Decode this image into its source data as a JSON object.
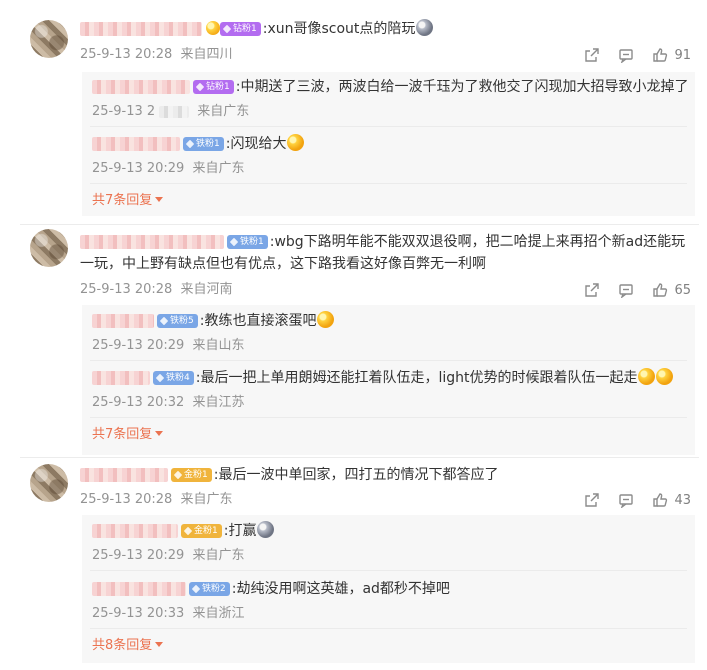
{
  "comments": [
    {
      "badge": {
        "label": "钻粉1",
        "color": "#b36cf0"
      },
      "text": ":xun哥像scout点的陪玩",
      "date": "25-9-13 20:28",
      "location": "来自四川",
      "likes": "91",
      "replies": [
        {
          "badge": {
            "label": "钻粉1",
            "color": "#b36cf0"
          },
          "text": ":中期送了三波，两波白给一波千珏为了救他交了闪现加大招导致小龙掉了",
          "date": "25-9-13 2",
          "location": "来自广东"
        },
        {
          "badge": {
            "label": "铁粉1",
            "color": "#7aa6e6"
          },
          "text": ":闪现给大",
          "date": "25-9-13 20:29",
          "location": "来自广东"
        }
      ],
      "more_label": "共7条回复"
    },
    {
      "badge": {
        "label": "铁粉1",
        "color": "#7aa6e6"
      },
      "text": ":wbg下路明年能不能双双退役啊，把二哈提上来再招个新ad还能玩一玩，中上野有缺点但也有优点，这下路我看这好像百弊无一利啊",
      "date": "25-9-13 20:28",
      "location": "来自河南",
      "likes": "65",
      "replies": [
        {
          "badge": {
            "label": "铁粉5",
            "color": "#7aa6e6"
          },
          "text": ":教练也直接滚蛋吧",
          "date": "25-9-13 20:29",
          "location": "来自山东"
        },
        {
          "badge": {
            "label": "铁粉4",
            "color": "#7aa6e6"
          },
          "text": ":最后一把上单用朗姆还能扛着队伍走，light优势的时候跟着队伍一起走",
          "date": "25-9-13 20:32",
          "location": "来自江苏"
        }
      ],
      "more_label": "共7条回复"
    },
    {
      "badge": {
        "label": "金粉1",
        "color": "#f0b43c"
      },
      "text": ":最后一波中单回家，四打五的情况下都答应了",
      "date": "25-9-13 20:28",
      "location": "来自广东",
      "likes": "43",
      "replies": [
        {
          "badge": {
            "label": "金粉1",
            "color": "#f0b43c"
          },
          "text": ":打赢",
          "date": "25-9-13 20:29",
          "location": "来自广东"
        },
        {
          "badge": {
            "label": "铁粉2",
            "color": "#7aa6e6"
          },
          "text": ":劫纯没用啊这英雄，ad都秒不掉吧",
          "date": "25-9-13 20:33",
          "location": "来自浙江"
        }
      ],
      "more_label": "共8条回复"
    }
  ],
  "icons": {
    "share": "share-icon",
    "comment": "comment-icon",
    "like": "like-icon"
  }
}
